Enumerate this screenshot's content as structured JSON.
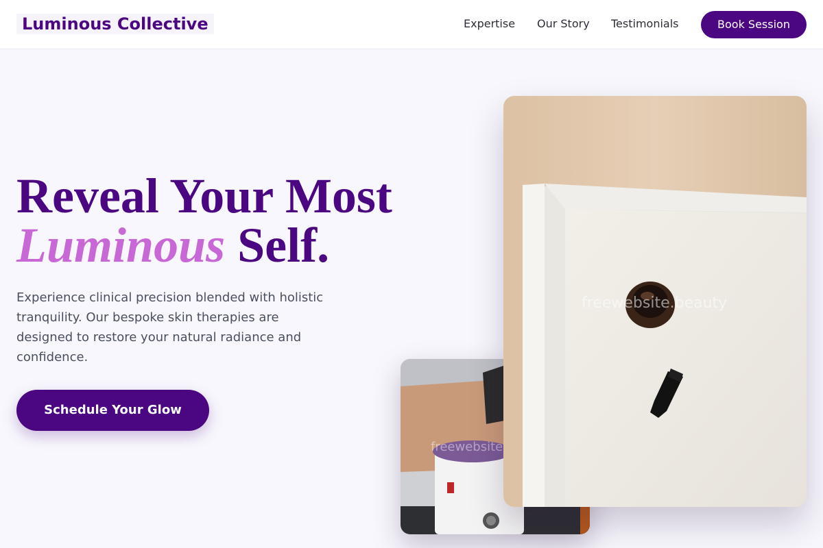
{
  "header": {
    "logo": "Luminous Collective",
    "nav": [
      "Expertise",
      "Our Story",
      "Testimonials"
    ],
    "book_label": "Book Session"
  },
  "hero": {
    "headline_line1": "Reveal Your Most",
    "headline_accent": "Luminous",
    "headline_end": " Self.",
    "lead": "Experience clinical precision blended with holistic tranquility. Our bespoke skin therapies are designed to restore your natural radiance and confidence.",
    "cta_label": "Schedule Your Glow"
  },
  "images": {
    "watermark": "freewebsite.beauty"
  },
  "colors": {
    "brand": "#4b0782",
    "accent": "#c868d6",
    "background": "#f8f7fd"
  }
}
